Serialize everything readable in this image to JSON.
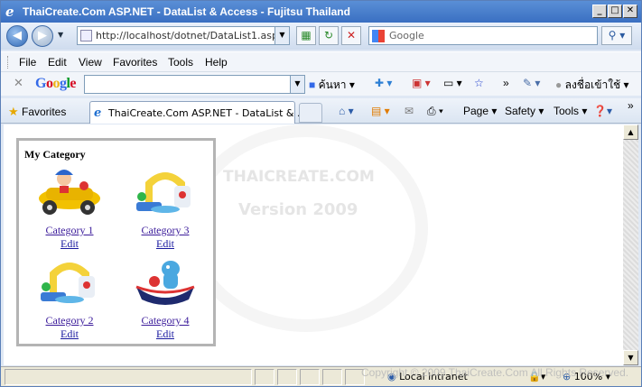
{
  "window": {
    "title": "ThaiCreate.Com ASP.NET - DataList & Access - Fujitsu Thailand",
    "min": "_",
    "max": "□",
    "close": "✕"
  },
  "nav": {
    "url": "http://localhost/dotnet/DataList1.aspx",
    "search_placeholder": "Google"
  },
  "menu": [
    "File",
    "Edit",
    "View",
    "Favorites",
    "Tools",
    "Help"
  ],
  "google_toolbar": {
    "logo": "Google",
    "search_label": "ค้นหา",
    "signin_label": "ลงชื่อเข้าใช้"
  },
  "tabs": {
    "favorites": "Favorites",
    "active_tab": "ThaiCreate.Com ASP.NET - DataList & ..."
  },
  "commandbar": {
    "page": "Page",
    "safety": "Safety",
    "tools": "Tools"
  },
  "page": {
    "heading": "My Category",
    "items": [
      {
        "label": "Category 1",
        "edit": "Edit",
        "icon": "toy-car-icon"
      },
      {
        "label": "Category 3",
        "edit": "Edit",
        "icon": "toy-playhouse-icon"
      },
      {
        "label": "Category 2",
        "edit": "Edit",
        "icon": "toy-playhouse-icon"
      },
      {
        "label": "Category 4",
        "edit": "Edit",
        "icon": "toy-boat-icon"
      }
    ],
    "watermark": {
      "line1": "THAICREATE.COM",
      "line2": "Version 2009"
    }
  },
  "status": {
    "zone": "Local intranet",
    "zoom": "100%",
    "copyright": "Copyright © 2009 ThaiCreate.Com All Rights Reserved."
  }
}
